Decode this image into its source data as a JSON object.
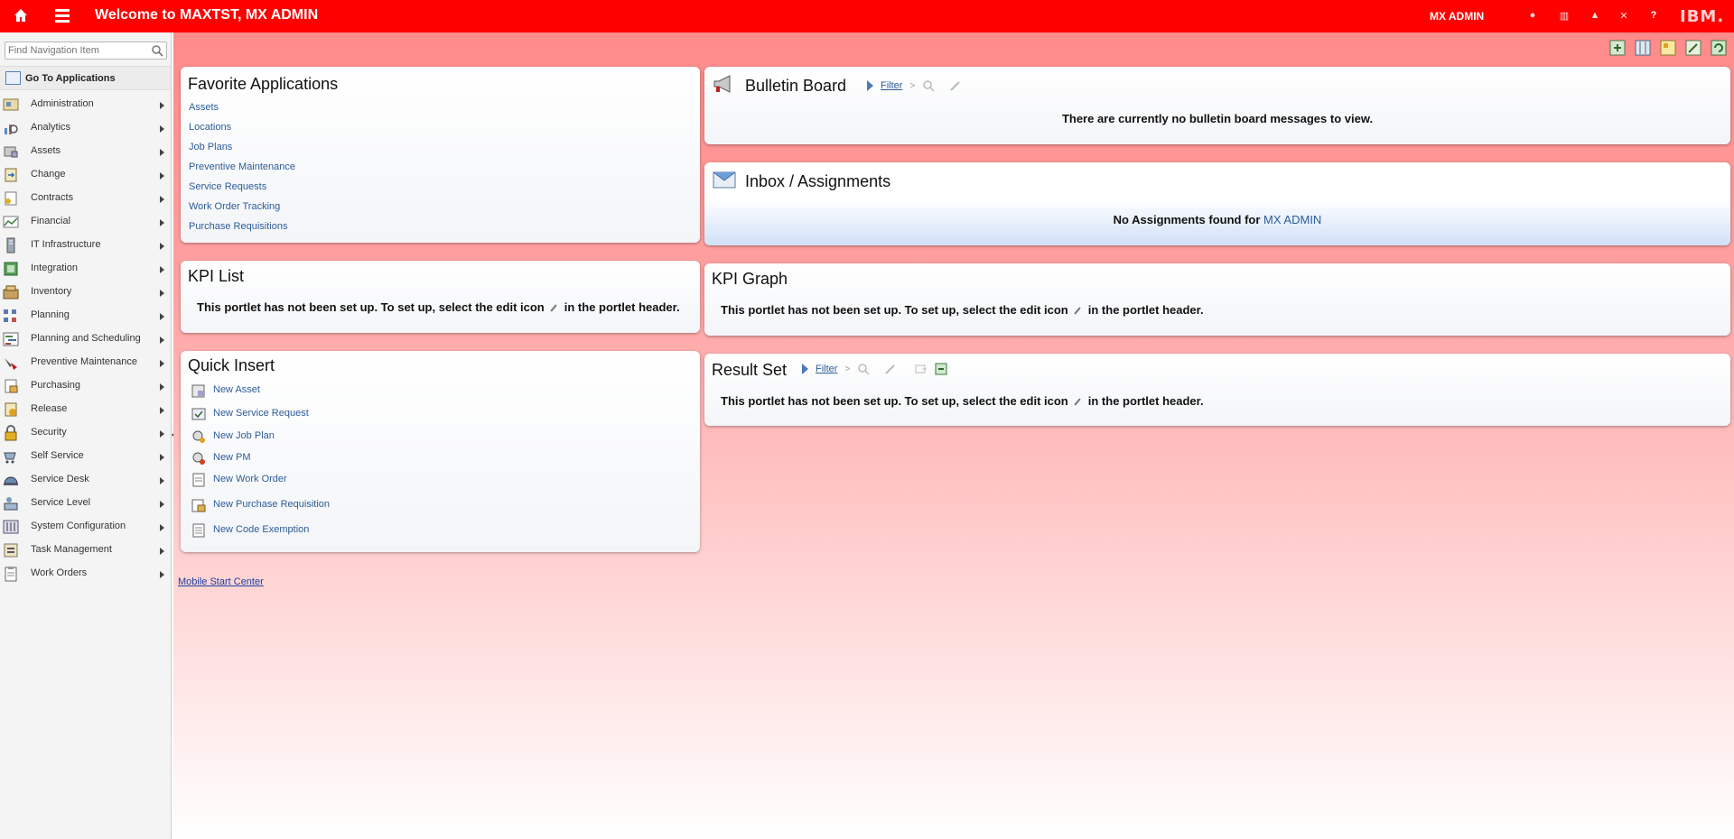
{
  "header": {
    "title": "Welcome to MAXTST, MX ADMIN",
    "user": "MX ADMIN",
    "logo": "IBM.",
    "icons": [
      "home-icon",
      "menu-icon",
      "alert-icon",
      "reports-icon",
      "profile-icon",
      "signout-icon",
      "help-icon"
    ]
  },
  "colors": {
    "header_bg": "#ff0000",
    "link": "#2d5c97",
    "main_gradient_top": "#ff8a8a"
  },
  "sidebar": {
    "search_placeholder": "Find Navigation Item",
    "goto_label": "Go To Applications",
    "items": [
      {
        "label": "Administration"
      },
      {
        "label": "Analytics"
      },
      {
        "label": "Assets"
      },
      {
        "label": "Change"
      },
      {
        "label": "Contracts"
      },
      {
        "label": "Financial"
      },
      {
        "label": "IT Infrastructure"
      },
      {
        "label": "Integration"
      },
      {
        "label": "Inventory"
      },
      {
        "label": "Planning"
      },
      {
        "label": "Planning and Scheduling"
      },
      {
        "label": "Preventive Maintenance"
      },
      {
        "label": "Purchasing"
      },
      {
        "label": "Release"
      },
      {
        "label": "Security"
      },
      {
        "label": "Self Service"
      },
      {
        "label": "Service Desk"
      },
      {
        "label": "Service Level"
      },
      {
        "label": "System Configuration"
      },
      {
        "label": "Task Management"
      },
      {
        "label": "Work Orders"
      }
    ]
  },
  "favorites": {
    "title": "Favorite Applications",
    "links": [
      "Assets",
      "Locations",
      "Job Plans",
      "Preventive Maintenance",
      "Service Requests",
      "Work Order Tracking",
      "Purchase Requisitions"
    ]
  },
  "bulletin": {
    "title": "Bulletin Board",
    "filter": "Filter",
    "message": "There are currently no bulletin board messages to view."
  },
  "inbox": {
    "title": "Inbox / Assignments",
    "message_prefix": "No Assignments found for ",
    "message_user": "MX ADMIN"
  },
  "kpi_list": {
    "title": "KPI List",
    "msg_before": "This portlet has not been set up. To set up, select the edit icon",
    "msg_after": "in the portlet header."
  },
  "kpi_graph": {
    "title": "KPI Graph",
    "msg_before": "This portlet has not been set up. To set up, select the edit icon",
    "msg_after": "in the portlet header."
  },
  "quick_insert": {
    "title": "Quick Insert",
    "items": [
      "New Asset",
      "New Service Request",
      "New Job Plan",
      "New PM",
      "New Work Order",
      "New Purchase Requisition",
      "New Code Exemption"
    ]
  },
  "result_set": {
    "title": "Result Set",
    "filter": "Filter",
    "msg_before": "This portlet has not been set up. To set up, select the edit icon",
    "msg_after": "in the portlet header."
  },
  "footer": {
    "mobile_link": "Mobile Start Center"
  }
}
